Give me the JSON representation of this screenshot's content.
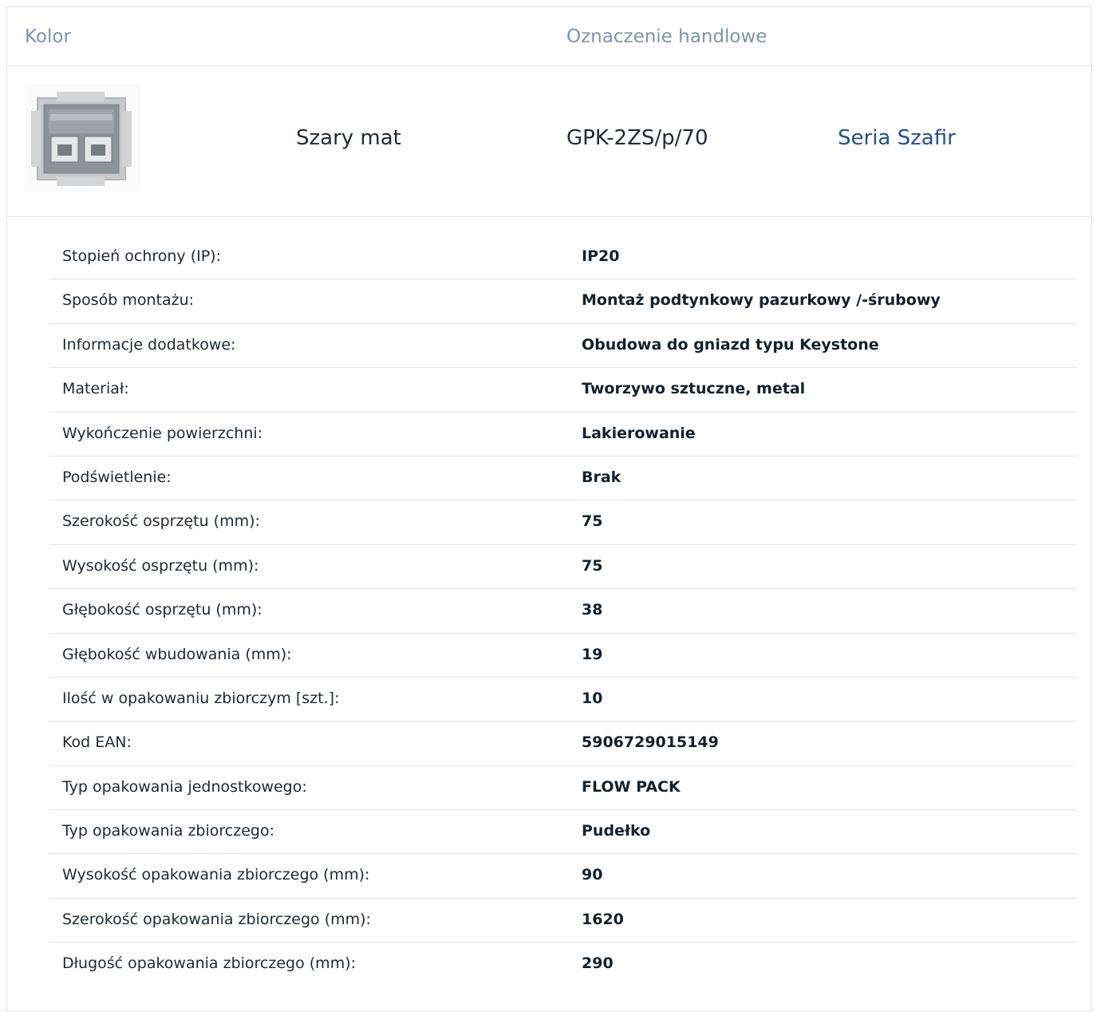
{
  "header": {
    "col1": "Kolor",
    "col2": "Oznaczenie handlowe"
  },
  "product": {
    "image_icon": "socket-frame-icon",
    "color": "Szary mat",
    "code": "GPK-2ZS/p/70",
    "series_link": "Seria Szafir"
  },
  "colors": {
    "header_text": "#7b93ad",
    "link": "#234f8f",
    "divider": "#dfe3e8"
  },
  "specs": [
    {
      "label": "Stopień ochrony (IP):",
      "value": "IP20"
    },
    {
      "label": "Sposób montażu:",
      "value": "Montaż podtynkowy pazurkowy /-śrubowy"
    },
    {
      "label": "Informacje dodatkowe:",
      "value": "Obudowa do gniazd typu Keystone"
    },
    {
      "label": "Materiał:",
      "value": "Tworzywo sztuczne, metal"
    },
    {
      "label": "Wykończenie powierzchni:",
      "value": "Lakierowanie"
    },
    {
      "label": "Podświetlenie:",
      "value": "Brak"
    },
    {
      "label": "Szerokość osprzętu (mm):",
      "value": "75"
    },
    {
      "label": "Wysokość osprzętu (mm):",
      "value": "75"
    },
    {
      "label": "Głębokość osprzętu (mm):",
      "value": "38"
    },
    {
      "label": "Głębokość wbudowania (mm):",
      "value": "19"
    },
    {
      "label": "Ilość w opakowaniu zbiorczym [szt.]:",
      "value": "10"
    },
    {
      "label": "Kod EAN:",
      "value": "5906729015149"
    },
    {
      "label": "Typ opakowania jednostkowego:",
      "value": "FLOW PACK"
    },
    {
      "label": "Typ opakowania zbiorczego:",
      "value": "Pudełko"
    },
    {
      "label": "Wysokość opakowania zbiorczego (mm):",
      "value": "90"
    },
    {
      "label": "Szerokość opakowania zbiorczego (mm):",
      "value": "1620"
    },
    {
      "label": "Długość opakowania zbiorczego (mm):",
      "value": "290"
    }
  ]
}
